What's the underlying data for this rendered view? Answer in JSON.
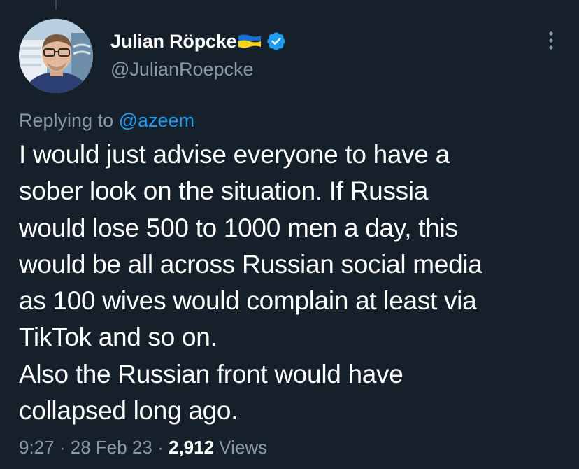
{
  "author": {
    "display_name": "Julian Röpcke",
    "handle": "@JulianRoepcke",
    "flag_icon": "ukraine-flag-icon",
    "verified_icon": "verified-badge-icon",
    "verified_color": "#1d9bf0"
  },
  "reply": {
    "prefix": "Replying to",
    "mention": "@azeem"
  },
  "tweet": {
    "lines": [
      "I would just advise everyone to have a",
      "sober look on the situation. If Russia",
      "would lose 500 to 1000 men a day, this",
      "would be all across Russian social media",
      "as 100 wives would complain at least via",
      "TikTok and so on.",
      "Also the Russian front would have",
      "collapsed long ago."
    ]
  },
  "meta": {
    "time": "9:27",
    "separator": "·",
    "date": "28 Feb 23",
    "views_count": "2,912",
    "views_label": "Views"
  },
  "colors": {
    "background": "#15202b",
    "text_primary": "#ffffff",
    "text_secondary": "#8b98a5",
    "link": "#1d9bf0"
  },
  "icons": {
    "more": "more-vertical-icon"
  }
}
